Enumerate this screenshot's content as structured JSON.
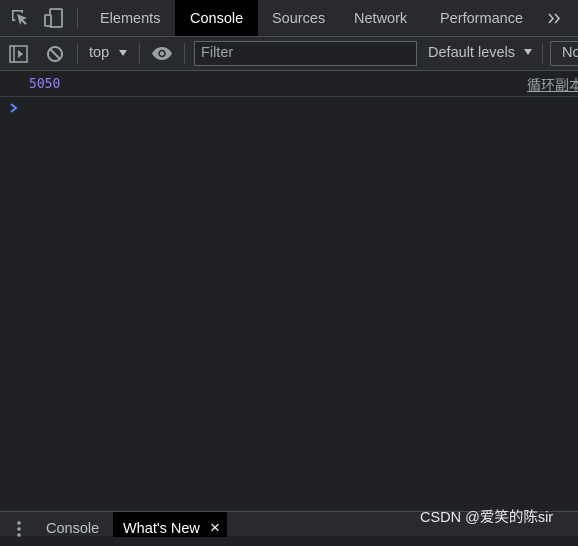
{
  "tabs": {
    "elements": "Elements",
    "console": "Console",
    "sources": "Sources",
    "network": "Network",
    "performance": "Performance"
  },
  "toolbar": {
    "context": "top",
    "filter_placeholder": "Filter",
    "levels": "Default levels",
    "hidden_label": "No"
  },
  "console": {
    "log_value": "5050",
    "log_source": "循环副本"
  },
  "drawer": {
    "console": "Console",
    "whats_new": "What's New",
    "close": "×"
  },
  "watermark": "CSDN @爱笑的陈sir",
  "colors": {
    "background": "#202124",
    "toolbar": "#292a2d",
    "active_tab": "#000000",
    "log_number": "#9980ff",
    "prompt": "#4e8cff",
    "text": "#bdc1c6"
  },
  "icons": [
    "inspect-element-icon",
    "device-toolbar-icon",
    "more-tabs-icon",
    "sidebar-toggle-icon",
    "clear-console-icon",
    "eye-icon",
    "console-prompt-icon",
    "drawer-menu-icon",
    "close-icon"
  ]
}
